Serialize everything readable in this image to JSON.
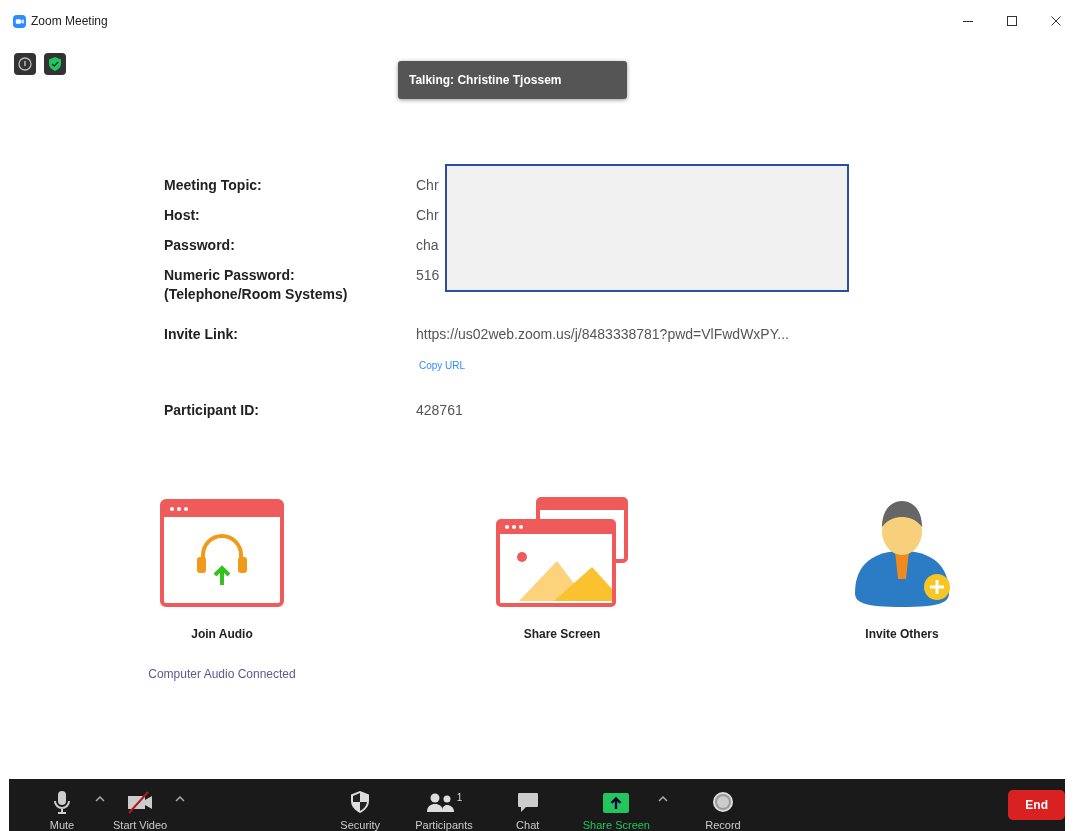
{
  "window": {
    "title": "Zoom Meeting"
  },
  "talking": "Talking: Christine Tjossem",
  "details": [
    {
      "label": "Meeting Topic:",
      "value": "Chr"
    },
    {
      "label": "Host:",
      "value": "Chr"
    },
    {
      "label": "Password:",
      "value": "cha"
    },
    {
      "label": "Numeric Password:",
      "sublabel": "(Telephone/Room Systems)",
      "value": "516"
    },
    {
      "label": "Invite Link:",
      "value": "https://us02web.zoom.us/j/8483338781?pwd=VlFwdWxPY...",
      "link": "Copy URL"
    },
    {
      "label": "Participant ID:",
      "value": "428761"
    }
  ],
  "actions": [
    {
      "kind": "audio",
      "label": "Join Audio",
      "note": "Computer Audio Connected"
    },
    {
      "kind": "share",
      "label": "Share Screen"
    },
    {
      "kind": "invite",
      "label": "Invite Others"
    }
  ],
  "toolbar": {
    "left": [
      {
        "kind": "mic",
        "label": "Mute",
        "caret": true,
        "active": false
      },
      {
        "kind": "video",
        "label": "Start Video",
        "caret": true,
        "active": false
      }
    ],
    "center": [
      {
        "kind": "security",
        "label": "Security",
        "caret": false,
        "active": false
      },
      {
        "kind": "participants",
        "label": "Participants",
        "count": "1",
        "caret": false,
        "active": false
      },
      {
        "kind": "chat",
        "label": "Chat",
        "caret": false,
        "active": false
      },
      {
        "kind": "share",
        "label": "Share Screen",
        "caret": true,
        "active": true
      },
      {
        "kind": "record",
        "label": "Record",
        "caret": false,
        "active": false
      }
    ],
    "end": "End"
  }
}
